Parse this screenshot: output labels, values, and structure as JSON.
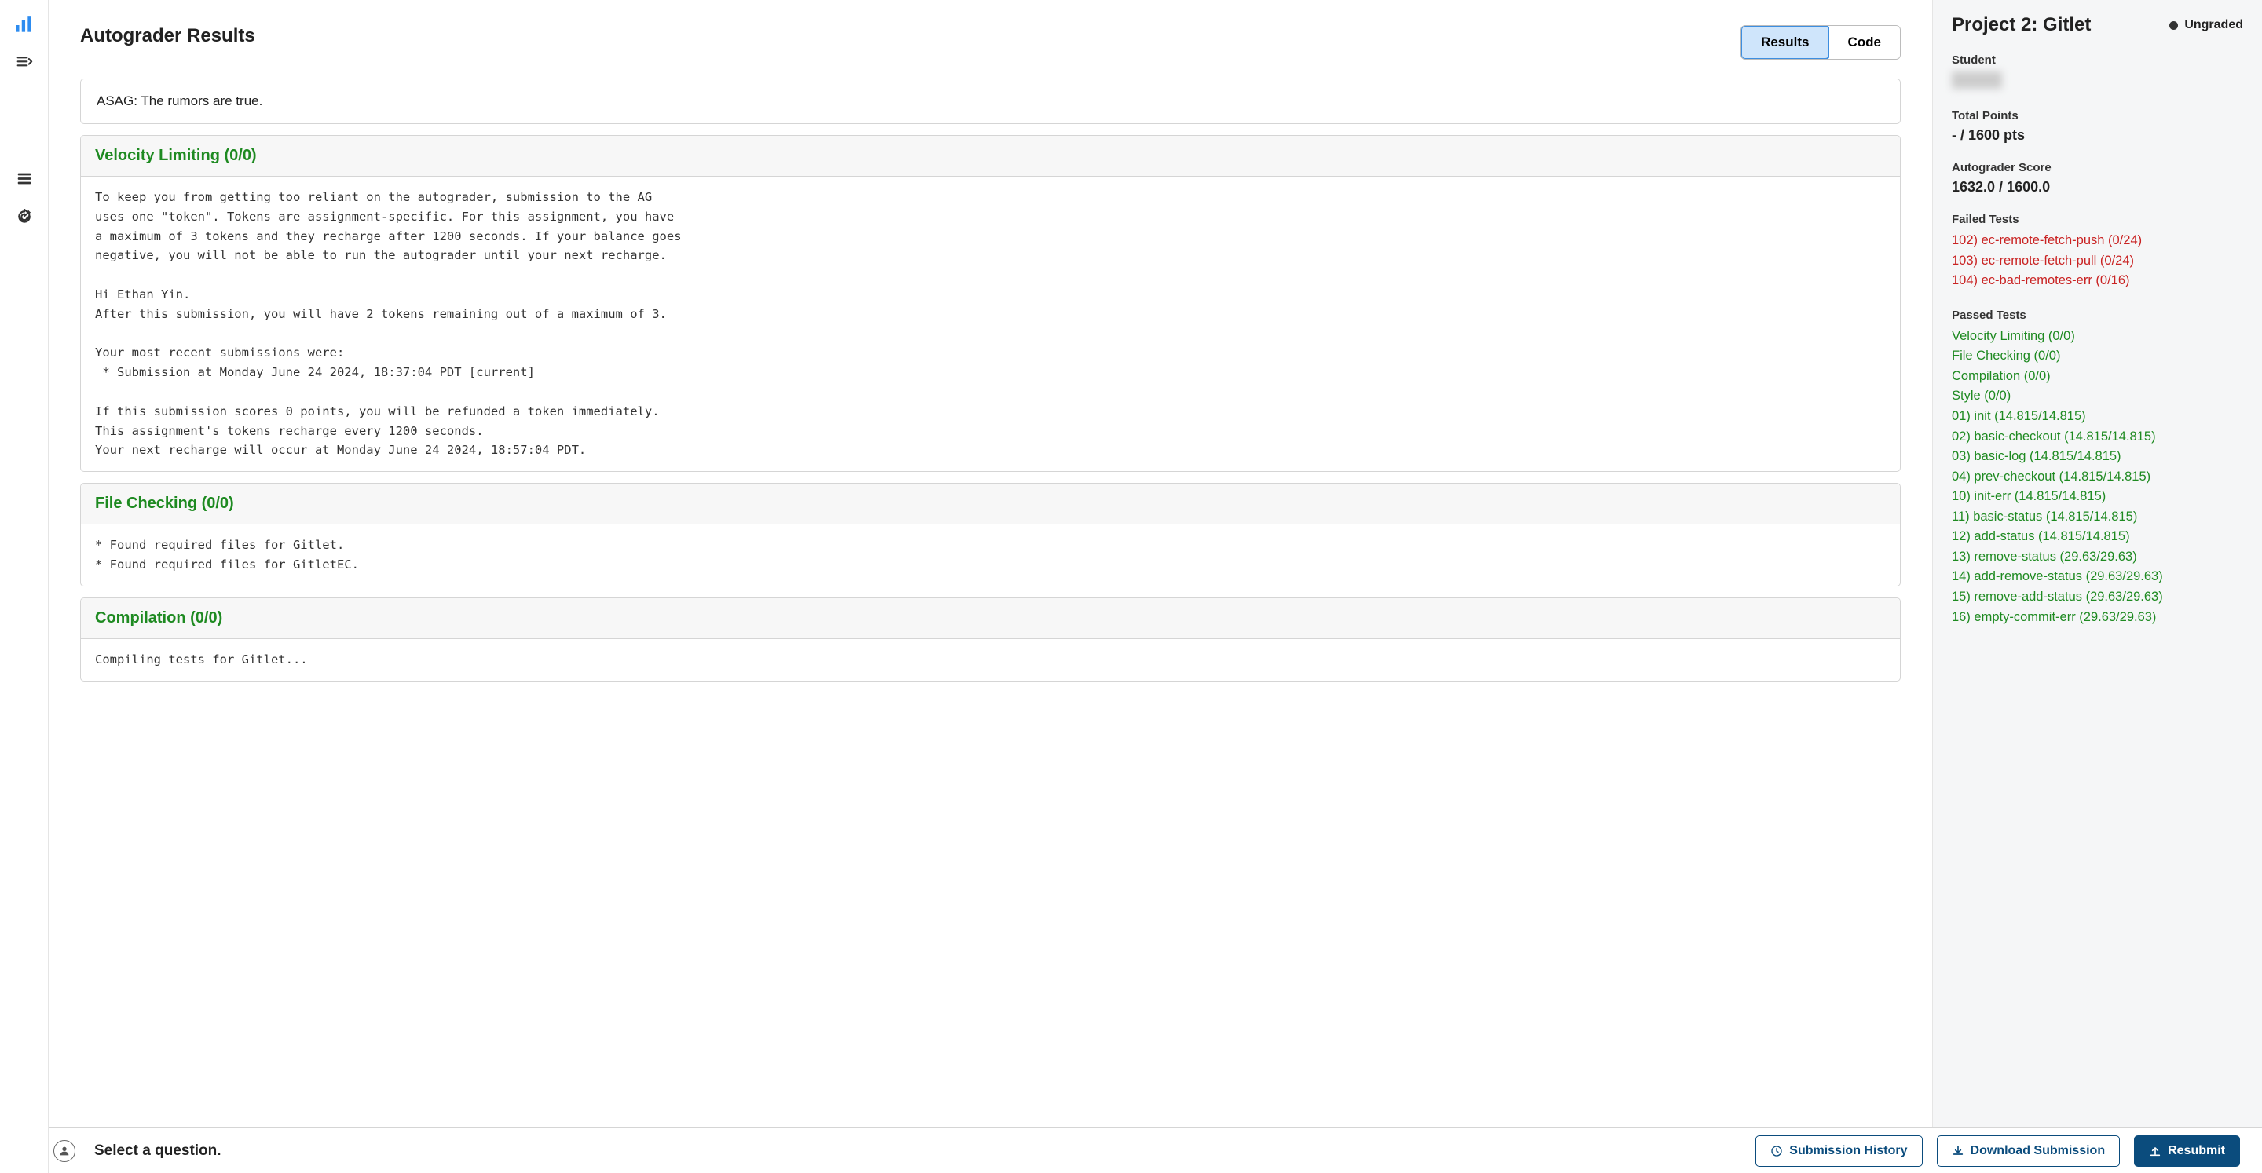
{
  "header": {
    "page_title": "Autograder Results",
    "tabs": {
      "results": "Results",
      "code": "Code"
    }
  },
  "asag_message": "ASAG: The rumors are true.",
  "sections": {
    "velocity": {
      "title": "Velocity Limiting (0/0)",
      "body": "To keep you from getting too reliant on the autograder, submission to the AG\nuses one \"token\". Tokens are assignment-specific. For this assignment, you have\na maximum of 3 tokens and they recharge after 1200 seconds. If your balance goes\nnegative, you will not be able to run the autograder until your next recharge.\n\nHi Ethan Yin.\nAfter this submission, you will have 2 tokens remaining out of a maximum of 3.\n\nYour most recent submissions were:\n * Submission at Monday June 24 2024, 18:37:04 PDT [current]\n\nIf this submission scores 0 points, you will be refunded a token immediately.\nThis assignment's tokens recharge every 1200 seconds.\nYour next recharge will occur at Monday June 24 2024, 18:57:04 PDT."
    },
    "filecheck": {
      "title": "File Checking (0/0)",
      "body": "* Found required files for Gitlet.\n* Found required files for GitletEC."
    },
    "compilation": {
      "title": "Compilation (0/0)",
      "body": "Compiling tests for Gitlet..."
    }
  },
  "right": {
    "project_title": "Project 2: Gitlet",
    "status": "Ungraded",
    "student_label": "Student",
    "total_points_label": "Total Points",
    "total_points_value": "- / 1600 pts",
    "autograder_label": "Autograder Score",
    "autograder_value": "1632.0 / 1600.0",
    "failed_label": "Failed Tests",
    "failed": [
      "102) ec-remote-fetch-push (0/24)",
      "103) ec-remote-fetch-pull (0/24)",
      "104) ec-bad-remotes-err (0/16)"
    ],
    "passed_label": "Passed Tests",
    "passed": [
      "Velocity Limiting (0/0)",
      "File Checking (0/0)",
      "Compilation (0/0)",
      "Style (0/0)",
      "01) init (14.815/14.815)",
      "02) basic-checkout (14.815/14.815)",
      "03) basic-log (14.815/14.815)",
      "04) prev-checkout (14.815/14.815)",
      "10) init-err (14.815/14.815)",
      "11) basic-status (14.815/14.815)",
      "12) add-status (14.815/14.815)",
      "13) remove-status (29.63/29.63)",
      "14) add-remove-status (29.63/29.63)",
      "15) remove-add-status (29.63/29.63)",
      "16) empty-commit-err (29.63/29.63)"
    ]
  },
  "footer": {
    "prompt": "Select a question.",
    "history": "Submission History",
    "download": "Download Submission",
    "resubmit": "Resubmit"
  }
}
